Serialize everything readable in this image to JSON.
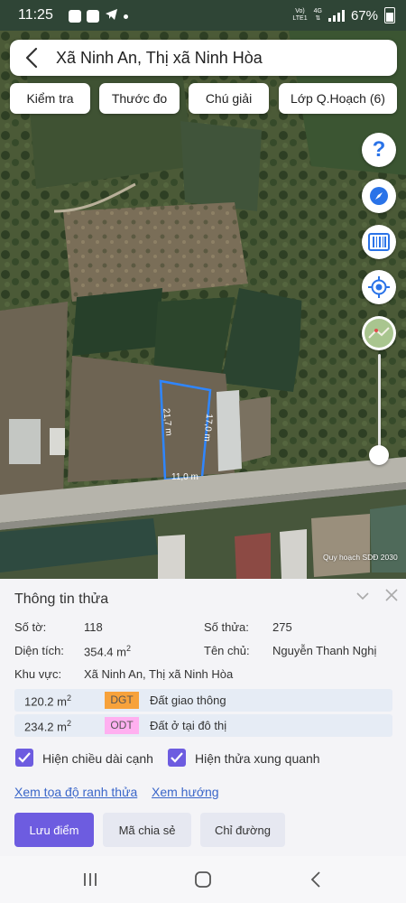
{
  "status_bar": {
    "time": "11:25",
    "network_label_top": "Vo)",
    "network_label_bottom": "LTE1",
    "data_type": "4G",
    "battery": "67%"
  },
  "header": {
    "title": "Xã Ninh An, Thị xã Ninh Hòa"
  },
  "toolbar": {
    "check_label": "Kiểm tra",
    "measure_label": "Thước đo",
    "legend_label": "Chú giải",
    "layers_label": "Lớp Q.Hoạch (6)"
  },
  "map": {
    "dimension_left": "21,7 m",
    "dimension_right": "17,0 m",
    "dimension_bottom": "11,0 m",
    "watermark": "Quy hoạch SDĐ 2030",
    "zoom_level": 0.05,
    "colors": {
      "parcel_outline": "#2f86ff"
    },
    "side_buttons": [
      "help-icon",
      "compass-icon",
      "barcode-icon",
      "my-location-icon",
      "map-layer-icon"
    ]
  },
  "parcel_info": {
    "title": "Thông tin thửa",
    "sheet_label": "Số tờ:",
    "sheet_value": "118",
    "parcel_label": "Số thửa:",
    "parcel_value": "275",
    "area_label": "Diện tích:",
    "area_value": "354.4 m",
    "area_unit_sup": "2",
    "owner_label": "Tên chủ:",
    "owner_value": "Nguyễn Thanh Nghị",
    "region_label": "Khu vực:",
    "region_value": "Xã Ninh An, Thị xã Ninh Hòa",
    "land_uses": [
      {
        "area": "120.2 m",
        "sup": "2",
        "code": "DGT",
        "code_color": "#f7a23b",
        "desc": "Đất giao thông"
      },
      {
        "area": "234.2 m",
        "sup": "2",
        "code": "ODT",
        "code_color": "#ffb0f0",
        "desc": "Đất ở tại đô thị"
      }
    ],
    "show_edge_length_label": "Hiện chiều dài cạnh",
    "show_neighbors_label": "Hiện thửa xung quanh",
    "coords_link": "Xem tọa độ ranh thửa",
    "direction_link": "Xem hướng",
    "save_button": "Lưu điểm",
    "share_button": "Mã chia sẻ",
    "route_button": "Chỉ đường"
  },
  "accent_color": "#6d5ce0"
}
